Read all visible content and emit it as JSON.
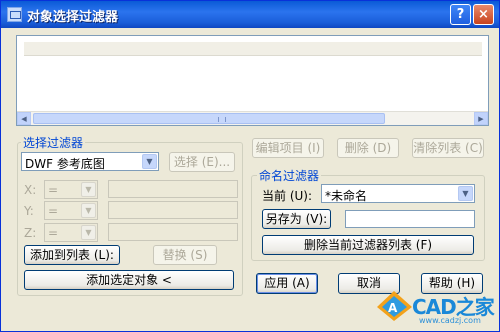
{
  "window": {
    "title": "对象选择过滤器"
  },
  "titlebar": {
    "help_label": "?",
    "close_label": "×"
  },
  "filter_group": {
    "title": "选择过滤器",
    "type_select": "DWF 参考底图",
    "select_button": "选择 (E)...",
    "x_label": "X:",
    "y_label": "Y:",
    "z_label": "Z:",
    "operator": "=",
    "add_to_list": "添加到列表 (L):",
    "substitute": "替换 (S)",
    "add_selected": "添加选定对象 <"
  },
  "list_actions": {
    "edit_item": "编辑项目 (I)",
    "delete": "删除 (D)",
    "clear_list": "清除列表 (C)"
  },
  "named_filters": {
    "title": "命名过滤器",
    "current_label": "当前 (U):",
    "current_value": "*未命名",
    "save_as": "另存为 (V):",
    "save_as_value": "",
    "delete_current": "删除当前过滤器列表 (F)"
  },
  "buttons": {
    "apply": "应用 (A)",
    "cancel": "取消",
    "help": "帮助 (H)"
  },
  "watermark": {
    "brand": "CAD之家",
    "url": "www.cadzj.com"
  }
}
